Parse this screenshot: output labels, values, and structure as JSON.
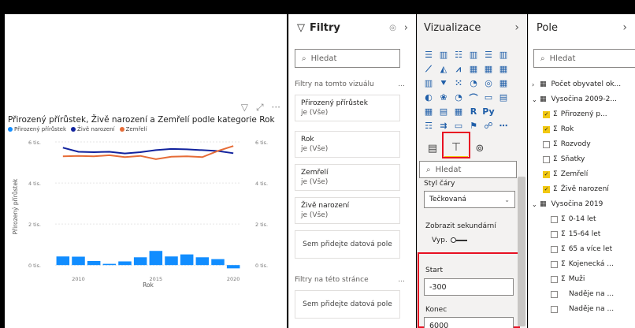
{
  "chart": {
    "title": "Přirozený přírůstek, Živě narození a Zemřelí podle kategorie Rok",
    "legend": [
      {
        "name": "Přirozený přírůstek",
        "color": "#118dff"
      },
      {
        "name": "Živě narození",
        "color": "#12239e"
      },
      {
        "name": "Zemřelí",
        "color": "#e66c37"
      }
    ],
    "y_axis_label": "Přirozený přírůstek",
    "x_axis_label": "Rok",
    "header_icons": [
      "filter-icon",
      "focus-mode-icon",
      "more-options-icon"
    ]
  },
  "chart_data": {
    "type": "bar",
    "xlabel": "Rok",
    "ylabel": "Přirozený přírůstek",
    "x_ticks": [
      "2010",
      "2015",
      "2020"
    ],
    "y_ticks_left": [
      "6 tis.",
      "4 tis.",
      "2 tis.",
      "0 tis."
    ],
    "y_ticks_right": [
      "6 tis.",
      "4 tis.",
      "2 tis.",
      "0 tis."
    ],
    "ylim": [
      -300,
      6000
    ],
    "categories": [
      "2009",
      "2010",
      "2011",
      "2012",
      "2013",
      "2014",
      "2015",
      "2016",
      "2017",
      "2018",
      "2019",
      "2020"
    ],
    "series": [
      {
        "name": "Přirozený přírůstek",
        "type": "bar",
        "color": "#118dff",
        "values": [
          420,
          410,
          200,
          60,
          180,
          380,
          690,
          420,
          520,
          380,
          290,
          -160
        ]
      },
      {
        "name": "Živě narození",
        "type": "line",
        "color": "#12239e",
        "values": [
          5720,
          5520,
          5500,
          5520,
          5440,
          5500,
          5600,
          5660,
          5640,
          5600,
          5560,
          5450
        ]
      },
      {
        "name": "Zemřelí",
        "type": "line",
        "color": "#e66c37",
        "values": [
          5300,
          5320,
          5300,
          5350,
          5260,
          5320,
          5160,
          5280,
          5300,
          5260,
          5560,
          5800
        ]
      }
    ],
    "grid": true
  },
  "filters": {
    "title": "Filtry",
    "search_placeholder": "Hledat",
    "on_visual_label": "Filtry na tomto vizuálu",
    "on_visual_more": "...",
    "cards": [
      {
        "name": "Přirozený přírůstek",
        "value": "je (Vše)"
      },
      {
        "name": "Rok",
        "value": "je (Vše)"
      },
      {
        "name": "Zemřelí",
        "value": "je (Vše)"
      },
      {
        "name": "Živě narození",
        "value": "je (Vše)"
      }
    ],
    "drop_here": "Sem přidejte datová pole",
    "on_page_label": "Filtry na této stránce",
    "on_page_more": "...",
    "drop_here_page": "Sem přidejte datová pole"
  },
  "viz": {
    "title": "Vizualizace",
    "chevron": "›",
    "search_placeholder": "Hledat",
    "line_style_label": "Styl čáry",
    "line_style_value": "Tečkovaná",
    "secondary_label": "Zobrazit sekundární",
    "toggle_label": "Vyp.",
    "start_label": "Start",
    "start_value": "-300",
    "end_label": "Konec",
    "end_value": "6000",
    "highlight_color": "#e81123"
  },
  "fields": {
    "title": "Pole",
    "search_placeholder": "Hledat",
    "tables": [
      {
        "label": "Počet obyvatel ok...",
        "expanded": false
      },
      {
        "label": "Vysočina 2009-2...",
        "expanded": true
      },
      {
        "label": "Vysočina 2019",
        "expanded": true
      }
    ],
    "table1_fields": [
      {
        "label": "Přirozený p...",
        "checked": true
      },
      {
        "label": "Rok",
        "checked": true
      },
      {
        "label": "Rozvody",
        "checked": false
      },
      {
        "label": "Sňatky",
        "checked": false
      },
      {
        "label": "Zemřelí",
        "checked": true
      },
      {
        "label": "Živě narození",
        "checked": true
      }
    ],
    "table2_fields": [
      {
        "label": "0-14 let",
        "sigma": true
      },
      {
        "label": "15-64 let",
        "sigma": true
      },
      {
        "label": "65 a více let",
        "sigma": true
      },
      {
        "label": "Kojenecká ...",
        "sigma": true
      },
      {
        "label": "Muži",
        "sigma": true
      },
      {
        "label": "Naděje na ...",
        "sigma": false
      },
      {
        "label": "Naděje na ...",
        "sigma": false
      }
    ]
  }
}
